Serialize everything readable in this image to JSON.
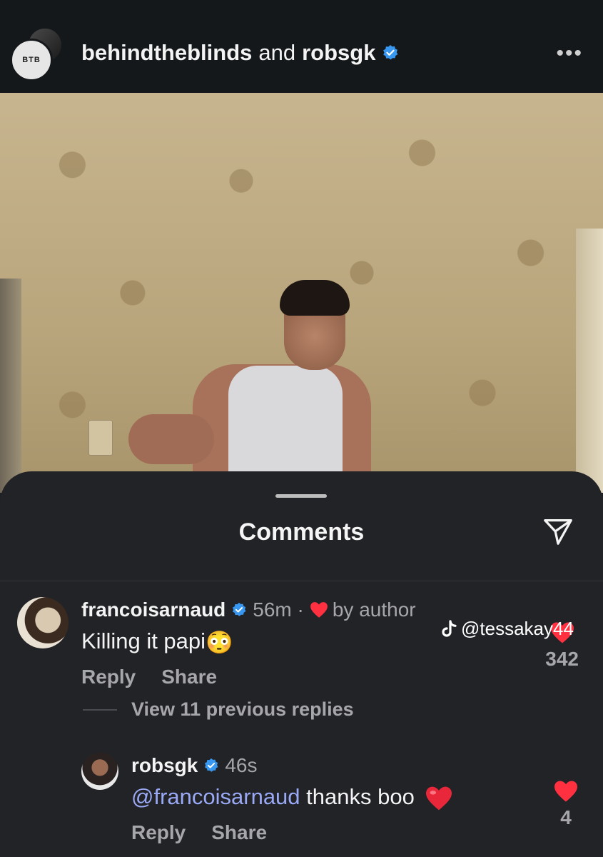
{
  "header": {
    "avatar_text": "BTB",
    "user1": "behindtheblinds",
    "and": "and",
    "user2": "robsgk",
    "more": "•••"
  },
  "sheet": {
    "title": "Comments"
  },
  "comments": [
    {
      "username": "francoisarnaud",
      "time": "56m ·",
      "by_author": "by author",
      "text": "Killing it papi",
      "emoji": "😳",
      "reply": "Reply",
      "share": "Share",
      "likes": "342"
    }
  ],
  "view_replies": "View 11 previous replies",
  "reply": {
    "username": "robsgk",
    "time": "46s",
    "mention": "@francoisarnaud",
    "text": "thanks boo",
    "reply": "Reply",
    "share": "Share",
    "likes": "4"
  },
  "watermark": "@tessakay44",
  "colors": {
    "verified": "#3897f0",
    "heart": "#ff3040",
    "mention": "#9aa9f5"
  }
}
